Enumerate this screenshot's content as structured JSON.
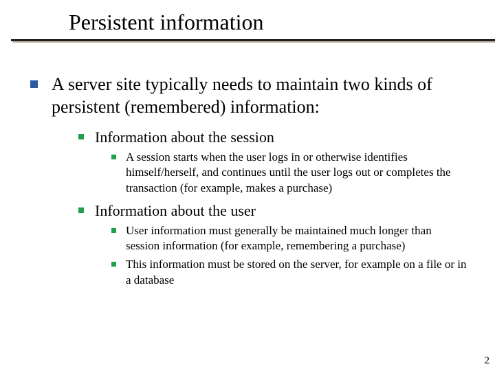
{
  "title": "Persistent information",
  "main": "A server site typically needs to maintain two kinds of persistent (remembered) information:",
  "sub": {
    "session": {
      "heading": "Information about the session",
      "items": [
        "A session starts when the user logs in or otherwise identifies himself/herself, and continues until the user logs out or completes the transaction (for example, makes a purchase)"
      ]
    },
    "user": {
      "heading": "Information about the user",
      "items": [
        "User information must generally be maintained much longer than session information (for example, remembering a purchase)",
        "This information must be stored on the server, for example on a file or in a database"
      ]
    }
  },
  "page_number": "2"
}
